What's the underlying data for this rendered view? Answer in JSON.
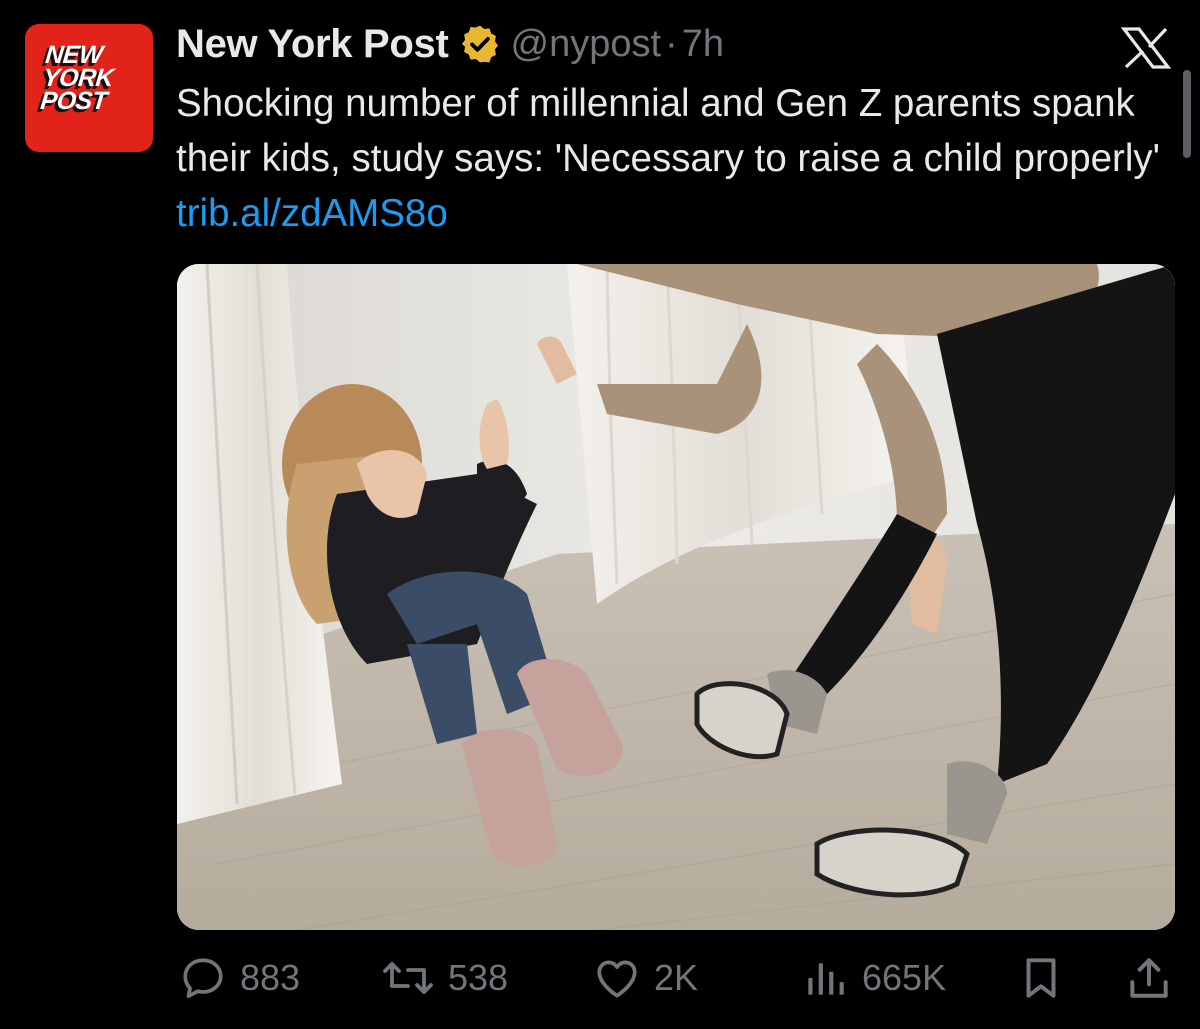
{
  "account": {
    "display_name": "New York Post",
    "handle": "@nypost",
    "separator": "·",
    "time": "7h",
    "avatar_lines": [
      "NEW",
      "YORK",
      "POST"
    ],
    "avatar_color": "#e2231a",
    "verified_color": "#e8b62f"
  },
  "tweet": {
    "text": "Shocking number of millennial and Gen Z parents spank their kids, study says: 'Necessary to raise a child properly' ",
    "link": "trib.al/zdAMS8o",
    "link_color": "#1d9bf0"
  },
  "media": {
    "type": "photo"
  },
  "actions": {
    "replies": "883",
    "reposts": "538",
    "likes": "2K",
    "views": "665K"
  },
  "icons": {
    "verified": "verified-badge-icon",
    "platform": "x-logo-icon",
    "reply": "reply-icon",
    "repost": "repost-icon",
    "like": "heart-icon",
    "views": "views-icon",
    "bookmark": "bookmark-icon",
    "share": "share-icon"
  }
}
